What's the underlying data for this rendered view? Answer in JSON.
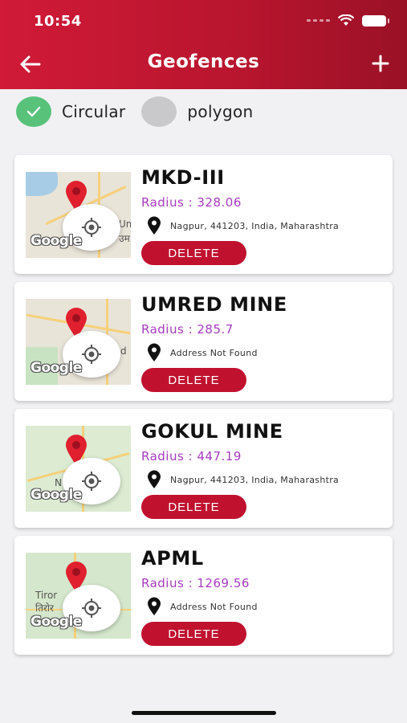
{
  "status_bar": {
    "time": "10:54"
  },
  "header": {
    "title": "Geofences",
    "back_icon": "arrow-left-icon",
    "add_label": "+"
  },
  "toggles": [
    {
      "label": "Circular",
      "selected": true
    },
    {
      "label": "polygon",
      "selected": false
    }
  ],
  "geofences": [
    {
      "name": "MKD-III",
      "radius": "Radius : 328.06",
      "address": "Nagpur, 441203, India, Maharashtra",
      "delete_label": "DELETE",
      "map_text": [
        "Um",
        "उम"
      ]
    },
    {
      "name": "UMRED MINE",
      "radius": "Radius : 285.7",
      "address": "Address Not Found",
      "delete_label": "DELETE",
      "map_text": [
        "d",
        ""
      ]
    },
    {
      "name": "GOKUL MINE",
      "radius": "Radius : 447.19",
      "address": "Nagpur, 441203, India, Maharashtra",
      "delete_label": "DELETE",
      "map_text": [
        "N",
        ""
      ]
    },
    {
      "name": "APML",
      "radius": "Radius : 1269.56",
      "address": "Address Not Found",
      "delete_label": "DELETE",
      "map_text": [
        "Tiror",
        "तिरोर"
      ]
    }
  ],
  "map_logo": "Google",
  "colors": {
    "header": "#c8183a",
    "accent_radius": "#a63bbf",
    "delete": "#c0122f",
    "toggle_on": "#58c27a",
    "toggle_off": "#c9c9cb"
  }
}
